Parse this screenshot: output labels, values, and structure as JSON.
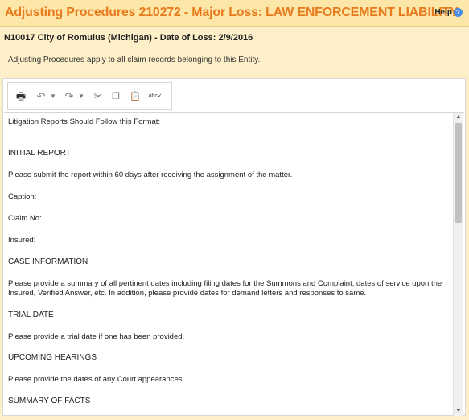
{
  "header": {
    "title": "Adjusting Procedures 210272 - Major Loss: LAW ENFORCEMENT LIABILITY",
    "help_label": "Help",
    "help_icon": "?"
  },
  "subtitle": "N10017 City of Romulus (Michigan) - Date of Loss: 2/9/2016",
  "note": "Adjusting Procedures apply to all claim records belonging to this Entity.",
  "toolbar": {
    "print": "🖶",
    "undo": "↶",
    "redo": "↷",
    "caret": "▼",
    "cut": "✂",
    "copy": "❐",
    "paste": "📋",
    "spellcheck": "abc✓"
  },
  "content": {
    "lines": [
      "Litigation Reports Should Follow this Format:",
      "INITIAL REPORT",
      "Please submit the report within 60 days after receiving the assignment of the matter.",
      "Caption:",
      "Claim No:",
      "Insured:",
      "CASE INFORMATION",
      "Please provide a summary of all pertinent dates including filing dates for the Summons and Complaint, dates of service upon the Insured, Verified Answer, etc. In addition, please provide dates for demand letters and responses to same.",
      "TRIAL DATE",
      "Please provide a trial date if one has been provided.",
      "UPCOMING HEARINGS",
      "Please provide the dates of any Court appearances.",
      "SUMMARY OF FACTS"
    ]
  },
  "scrollbar": {
    "up": "▲",
    "down": "▼"
  }
}
